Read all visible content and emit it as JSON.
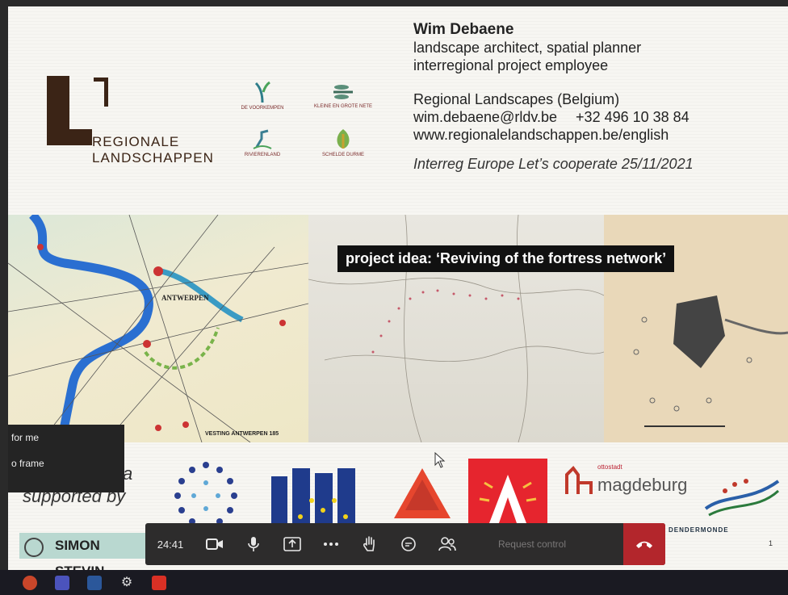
{
  "slide": {
    "logo": {
      "line1": "REGIONALE",
      "line2": "LANDSCHAPPEN"
    },
    "partners": [
      "DE VOORKEMPEN",
      "KLEINE EN GROTE NETE",
      "RIVIERENLAND",
      "SCHELDE DURME"
    ],
    "contact": {
      "name": "Wim Debaene",
      "role1": "landscape architect, spatial planner",
      "role2": "interregional project employee",
      "org": "Regional Landscapes (Belgium)",
      "email": "wim.debaene@rldv.be",
      "phone": "+32 496 10 38 84",
      "web": "www.regionalelandschappen.be/english",
      "event": "Interreg Europe Let’s cooperate 25/11/2021"
    },
    "map_caption": "project idea: ‘Reviving of the fortress network’",
    "map_labels": {
      "city": "ANTWERPEN",
      "footer": "VESTING ANTWERPEN 185"
    },
    "supported_by": "supported by",
    "supported_a": "a",
    "simon_stevin": "SIMON STEVIN",
    "magdeburg": "magdeburg",
    "magdeburg_small": "ottostadt",
    "dendermonde": "DENDERMONDE",
    "page_number": "1"
  },
  "context_menu": {
    "items": [
      "for me",
      "o frame"
    ]
  },
  "toolbar": {
    "timer": "24:41",
    "request_control": "Request control",
    "icons": [
      "camera-icon",
      "microphone-icon",
      "share-screen-icon",
      "more-icon",
      "raise-hand-icon",
      "chat-icon",
      "participants-icon",
      "hang-up-icon"
    ]
  },
  "colors": {
    "toolbar_bg": "#2d2c2c",
    "hangup": "#b3262c",
    "logo_brown": "#3b2416",
    "river_blue": "#2a6fd1"
  }
}
